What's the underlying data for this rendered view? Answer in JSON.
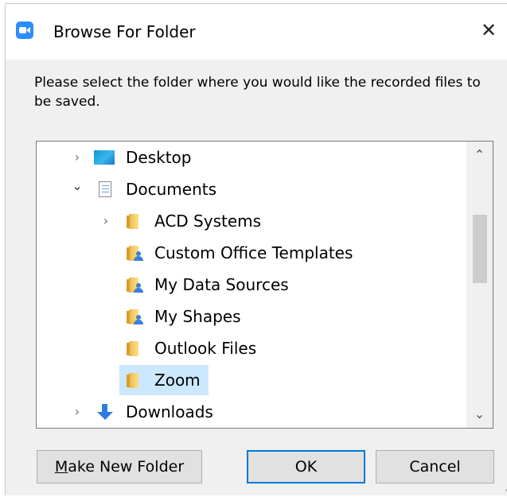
{
  "window": {
    "title": "Browse For Folder",
    "app_icon": "zoom-camera-icon",
    "close_glyph": "✕"
  },
  "prompt": "Please select the folder where you would like the recorded files to be saved.",
  "tree": {
    "selected": "Zoom",
    "items": [
      {
        "label": "Desktop",
        "icon": "desktop-icon",
        "expander": "collapsed"
      },
      {
        "label": "Documents",
        "icon": "documents-icon",
        "expander": "expanded"
      },
      {
        "label": "ACD Systems",
        "icon": "folder-icon",
        "expander": "collapsed"
      },
      {
        "label": "Custom Office Templates",
        "icon": "user-folder-icon",
        "expander": "none"
      },
      {
        "label": "My Data Sources",
        "icon": "user-folder-icon",
        "expander": "none"
      },
      {
        "label": "My Shapes",
        "icon": "user-folder-icon",
        "expander": "none"
      },
      {
        "label": "Outlook Files",
        "icon": "folder-icon",
        "expander": "none"
      },
      {
        "label": "Zoom",
        "icon": "folder-icon",
        "expander": "none"
      },
      {
        "label": "Downloads",
        "icon": "download-icon",
        "expander": "collapsed"
      }
    ],
    "chevron_right": "›",
    "chevron_down": "⌄",
    "scroll_up_glyph": "⌃",
    "scroll_down_glyph": "⌄"
  },
  "buttons": {
    "make_new_folder_mnemonic": "M",
    "make_new_folder_rest": "ake New Folder",
    "ok": "OK",
    "cancel": "Cancel"
  },
  "colors": {
    "accent": "#0078d7",
    "selection": "#cce8ff",
    "zoom_brand": "#2d8cff"
  }
}
